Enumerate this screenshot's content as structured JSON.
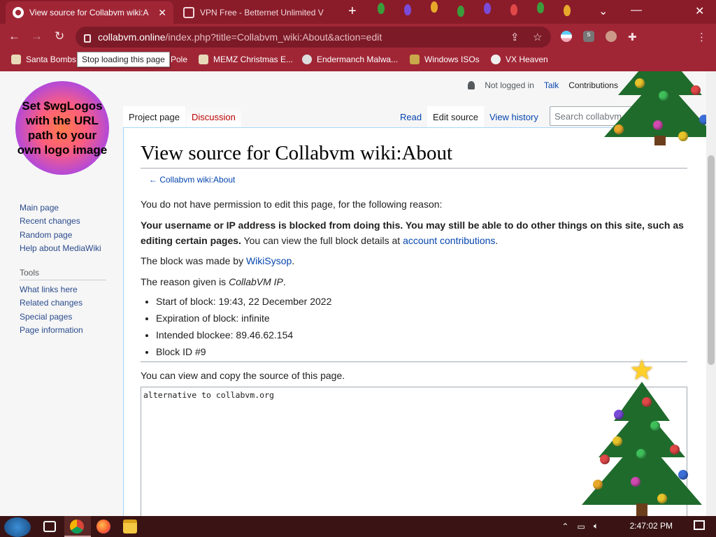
{
  "browser": {
    "tabs": [
      {
        "title": "View source for Collabvm wiki:A",
        "active": true
      },
      {
        "title": "VPN Free - Betternet Unlimited V",
        "active": false
      }
    ],
    "url_host": "collabvm.online",
    "url_path": "/index.php?title=Collabvm_wiki:About&action=edit",
    "tooltip": "Stop loading this page",
    "bookmarks": [
      "Santa Bombs",
      "Pole",
      "MEMZ Christmas E...",
      "Endermanch Malwa...",
      "Windows ISOs",
      "VX Heaven"
    ]
  },
  "wiki": {
    "logo_text": "Set $wgLogos with the URL path to your own logo image",
    "nav_links": [
      "Main page",
      "Recent changes",
      "Random page",
      "Help about MediaWiki"
    ],
    "tools_heading": "Tools",
    "tool_links": [
      "What links here",
      "Related changes",
      "Special pages",
      "Page information"
    ],
    "personal": {
      "not_logged_in": "Not logged in",
      "talk": "Talk",
      "contributions": "Contributions",
      "create": "Crea"
    },
    "tabs": {
      "project": "Project page",
      "discussion": "Discussion",
      "read": "Read",
      "edit_source": "Edit source",
      "view_history": "View history"
    },
    "search_placeholder": "Search collabvm",
    "heading": "View source for Collabvm wiki:About",
    "backlink": "← Collabvm wiki:About",
    "no_permission": "You do not have permission to edit this page, for the following reason:",
    "blocked_bold": "Your username or IP address is blocked from doing this. You may still be able to do other things on this site, such as editing certain pages.",
    "block_details_prefix": "You can view the full block details at",
    "block_details_link": "account contributions",
    "block_made_prefix": "The block was made by",
    "block_made_by": "WikiSysop",
    "reason_prefix": "The reason given is",
    "reason": "CollabVM IP",
    "block_items": [
      "Start of block: 19:43, 22 December 2022",
      "Expiration of block: infinite",
      "Intended blockee: 89.46.62.154",
      "Block ID #9"
    ],
    "view_source_text": "You can view and copy the source of this page.",
    "source": "alternative to collabvm.org"
  },
  "taskbar": {
    "clock": "2:47:02 PM"
  },
  "colors": {
    "chrome_dark": "#8a1c2a",
    "chrome": "#a02636",
    "link": "#0645ad",
    "new_link": "#ba0000"
  }
}
